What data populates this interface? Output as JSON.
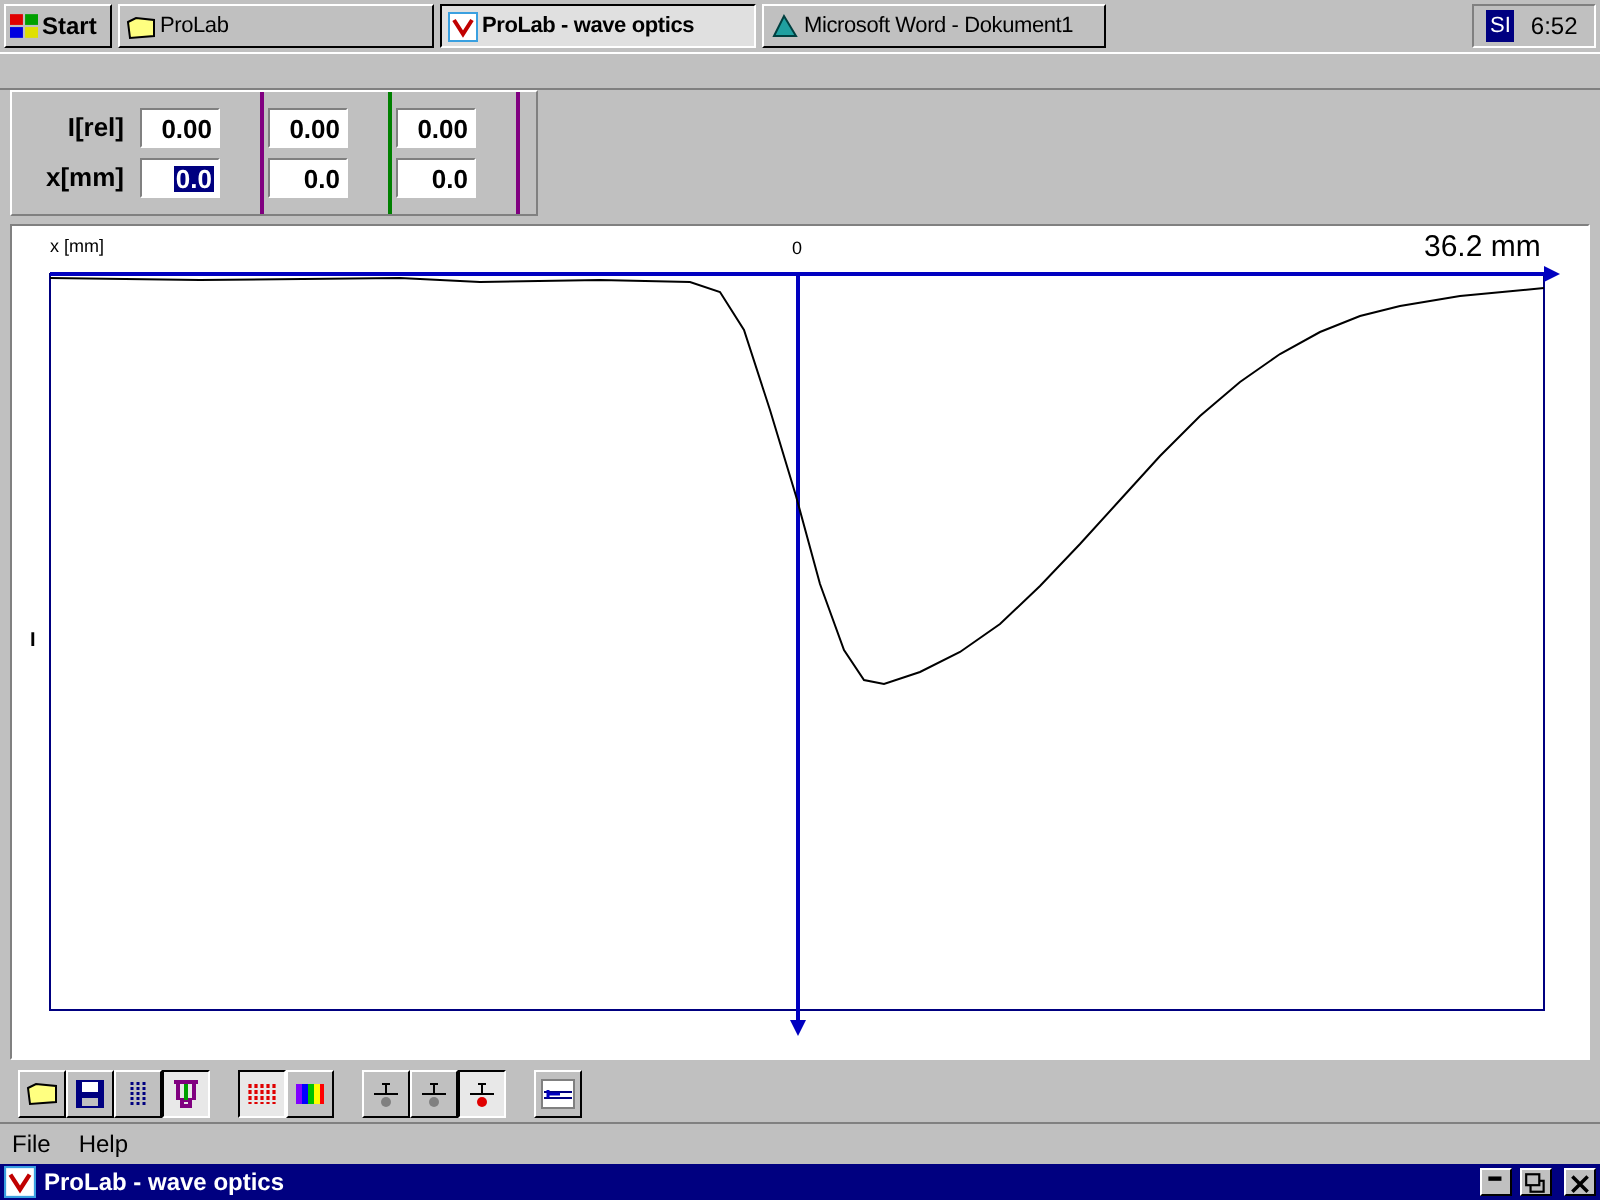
{
  "window": {
    "title": "ProLab - wave optics"
  },
  "menu": [
    "File",
    "Help"
  ],
  "toolbar": [
    {
      "kind": "folder",
      "pressed": false,
      "disabled": false
    },
    {
      "kind": "floppy",
      "pressed": false,
      "disabled": false
    },
    {
      "kind": "list",
      "pressed": false,
      "disabled": false
    },
    {
      "kind": "stand",
      "pressed": true,
      "disabled": false
    },
    {
      "kind": "bars",
      "pressed": true,
      "disabled": false
    },
    {
      "kind": "spectrum",
      "pressed": false,
      "disabled": false
    },
    {
      "kind": "probe",
      "pressed": false,
      "disabled": true
    },
    {
      "kind": "probe",
      "pressed": false,
      "disabled": true
    },
    {
      "kind": "probe",
      "pressed": true,
      "disabled": false
    },
    {
      "kind": "marker",
      "pressed": false,
      "disabled": false
    }
  ],
  "plot": {
    "xlabel": "x [mm]",
    "zero_label": "0",
    "range_label": "36.2 mm",
    "ylabel": "I"
  },
  "readout": {
    "rows": [
      {
        "label": "I[rel]",
        "values": [
          {
            "text": "0.00",
            "selected": false
          },
          {
            "text": "0.00",
            "selected": false
          },
          {
            "text": "0.00",
            "selected": false
          }
        ]
      },
      {
        "label": "x[mm]",
        "values": [
          {
            "text": "0.0",
            "selected": true
          },
          {
            "text": "0.0",
            "selected": false
          },
          {
            "text": "0.0",
            "selected": false
          }
        ]
      }
    ],
    "separators": [
      {
        "color": "#800080"
      },
      {
        "color": "#008000"
      },
      {
        "color": "#800080"
      }
    ]
  },
  "taskbar": {
    "start": "Start",
    "buttons": [
      {
        "label": "ProLab",
        "selected": false,
        "kind": "folder"
      },
      {
        "label": "ProLab - wave optics",
        "selected": true,
        "kind": "app"
      },
      {
        "label": "Microsoft Word - Dokument1",
        "selected": false,
        "kind": "word"
      }
    ],
    "language": "SI",
    "clock": "6:52"
  }
}
